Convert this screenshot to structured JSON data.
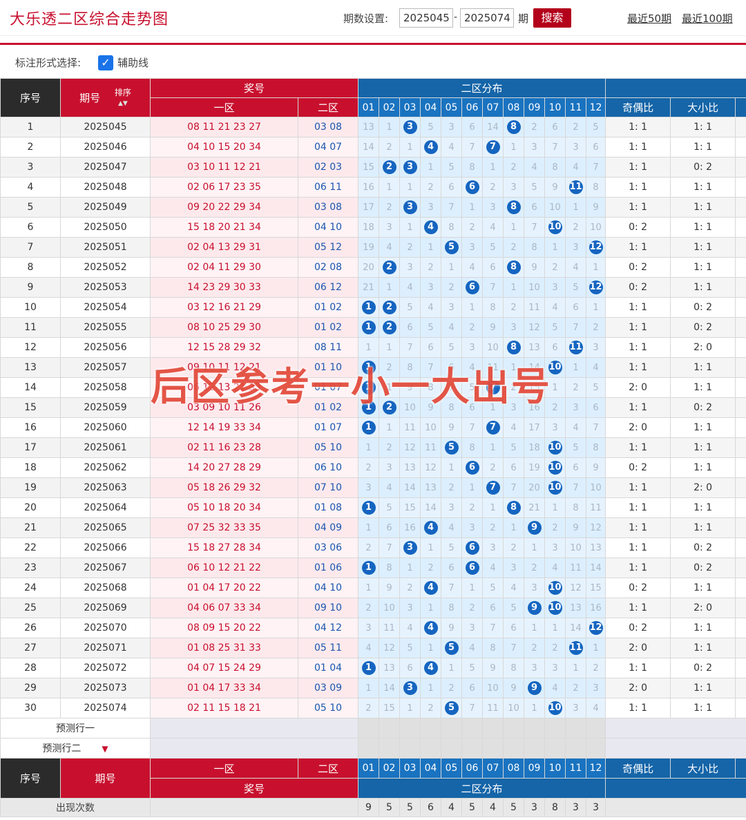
{
  "header": {
    "title": "大乐透二区综合走势图",
    "period_label": "期数设置:",
    "period_start": "2025045",
    "period_sep": "-",
    "period_end": "2025074",
    "period_unit": "期",
    "search_label": "搜索",
    "recent_50": "最近50期",
    "recent_100": "最近100期"
  },
  "options": {
    "label": "标注形式选择:",
    "aux_line_label": "辅助线",
    "aux_line_checked": true
  },
  "table_head": {
    "seq": "序号",
    "issue": "期号",
    "sort": "排序",
    "prize": "奖号",
    "zone1": "一区",
    "zone2": "二区",
    "dist": "二区分布",
    "odd_even": "奇偶比",
    "big_small": "大小比",
    "numbers": [
      "01",
      "02",
      "03",
      "04",
      "05",
      "06",
      "07",
      "08",
      "09",
      "10",
      "11",
      "12"
    ]
  },
  "rows": [
    {
      "seq": "1",
      "issue": "2025045",
      "front": "08 11 21 23 27",
      "back": "03 08",
      "cells": [
        "13",
        "1",
        "3",
        "5",
        "3",
        "6",
        "14",
        "8",
        "2",
        "6",
        "2",
        "5"
      ],
      "odd_even": "1: 1",
      "big_small": "1: 1"
    },
    {
      "seq": "2",
      "issue": "2025046",
      "front": "04 10 15 20 34",
      "back": "04 07",
      "cells": [
        "14",
        "2",
        "1",
        "4",
        "4",
        "7",
        "7",
        "1",
        "3",
        "7",
        "3",
        "6"
      ],
      "odd_even": "1: 1",
      "big_small": "1: 1"
    },
    {
      "seq": "3",
      "issue": "2025047",
      "front": "03 10 11 12 21",
      "back": "02 03",
      "cells": [
        "15",
        "2",
        "3",
        "1",
        "5",
        "8",
        "1",
        "2",
        "4",
        "8",
        "4",
        "7"
      ],
      "odd_even": "1: 1",
      "big_small": "0: 2"
    },
    {
      "seq": "4",
      "issue": "2025048",
      "front": "02 06 17 23 35",
      "back": "06 11",
      "cells": [
        "16",
        "1",
        "1",
        "2",
        "6",
        "6",
        "2",
        "3",
        "5",
        "9",
        "11",
        "8"
      ],
      "odd_even": "1: 1",
      "big_small": "1: 1"
    },
    {
      "seq": "5",
      "issue": "2025049",
      "front": "09 20 22 29 34",
      "back": "03 08",
      "cells": [
        "17",
        "2",
        "3",
        "3",
        "7",
        "1",
        "3",
        "8",
        "6",
        "10",
        "1",
        "9"
      ],
      "odd_even": "1: 1",
      "big_small": "1: 1"
    },
    {
      "seq": "6",
      "issue": "2025050",
      "front": "15 18 20 21 34",
      "back": "04 10",
      "cells": [
        "18",
        "3",
        "1",
        "4",
        "8",
        "2",
        "4",
        "1",
        "7",
        "10",
        "2",
        "10"
      ],
      "odd_even": "0: 2",
      "big_small": "1: 1"
    },
    {
      "seq": "7",
      "issue": "2025051",
      "front": "02 04 13 29 31",
      "back": "05 12",
      "cells": [
        "19",
        "4",
        "2",
        "1",
        "5",
        "3",
        "5",
        "2",
        "8",
        "1",
        "3",
        "12"
      ],
      "odd_even": "1: 1",
      "big_small": "1: 1"
    },
    {
      "seq": "8",
      "issue": "2025052",
      "front": "02 04 11 29 30",
      "back": "02 08",
      "cells": [
        "20",
        "2",
        "3",
        "2",
        "1",
        "4",
        "6",
        "8",
        "9",
        "2",
        "4",
        "1"
      ],
      "odd_even": "0: 2",
      "big_small": "1: 1"
    },
    {
      "seq": "9",
      "issue": "2025053",
      "front": "14 23 29 30 33",
      "back": "06 12",
      "cells": [
        "21",
        "1",
        "4",
        "3",
        "2",
        "6",
        "7",
        "1",
        "10",
        "3",
        "5",
        "12"
      ],
      "odd_even": "0: 2",
      "big_small": "1: 1"
    },
    {
      "seq": "10",
      "issue": "2025054",
      "front": "03 12 16 21 29",
      "back": "01 02",
      "cells": [
        "1",
        "2",
        "5",
        "4",
        "3",
        "1",
        "8",
        "2",
        "11",
        "4",
        "6",
        "1"
      ],
      "odd_even": "1: 1",
      "big_small": "0: 2"
    },
    {
      "seq": "11",
      "issue": "2025055",
      "front": "08 10 25 29 30",
      "back": "01 02",
      "cells": [
        "1",
        "2",
        "6",
        "5",
        "4",
        "2",
        "9",
        "3",
        "12",
        "5",
        "7",
        "2"
      ],
      "odd_even": "1: 1",
      "big_small": "0: 2"
    },
    {
      "seq": "12",
      "issue": "2025056",
      "front": "12 15 28 29 32",
      "back": "08 11",
      "cells": [
        "1",
        "1",
        "7",
        "6",
        "5",
        "3",
        "10",
        "8",
        "13",
        "6",
        "11",
        "3"
      ],
      "odd_even": "1: 1",
      "big_small": "2: 0"
    },
    {
      "seq": "13",
      "issue": "2025057",
      "front": "09 10 11 12 21",
      "back": "01 10",
      "cells": [
        "1",
        "2",
        "8",
        "7",
        "6",
        "4",
        "11",
        "1",
        "14",
        "10",
        "1",
        "4"
      ],
      "odd_even": "1: 1",
      "big_small": "1: 1"
    },
    {
      "seq": "14",
      "issue": "2025058",
      "front": "06 12 13 21 33",
      "back": "01 07",
      "cells": [
        "1",
        "1",
        "9",
        "8",
        "7",
        "5",
        "7",
        "2",
        "15",
        "1",
        "2",
        "5"
      ],
      "odd_even": "2: 0",
      "big_small": "1: 1"
    },
    {
      "seq": "15",
      "issue": "2025059",
      "front": "03 09 10 11 26",
      "back": "01 02",
      "cells": [
        "1",
        "2",
        "10",
        "9",
        "8",
        "6",
        "1",
        "3",
        "16",
        "2",
        "3",
        "6"
      ],
      "odd_even": "1: 1",
      "big_small": "0: 2"
    },
    {
      "seq": "16",
      "issue": "2025060",
      "front": "12 14 19 33 34",
      "back": "01 07",
      "cells": [
        "1",
        "1",
        "11",
        "10",
        "9",
        "7",
        "7",
        "4",
        "17",
        "3",
        "4",
        "7"
      ],
      "odd_even": "2: 0",
      "big_small": "1: 1"
    },
    {
      "seq": "17",
      "issue": "2025061",
      "front": "02 11 16 23 28",
      "back": "05 10",
      "cells": [
        "1",
        "2",
        "12",
        "11",
        "5",
        "8",
        "1",
        "5",
        "18",
        "10",
        "5",
        "8"
      ],
      "odd_even": "1: 1",
      "big_small": "1: 1"
    },
    {
      "seq": "18",
      "issue": "2025062",
      "front": "14 20 27 28 29",
      "back": "06 10",
      "cells": [
        "2",
        "3",
        "13",
        "12",
        "1",
        "6",
        "2",
        "6",
        "19",
        "10",
        "6",
        "9"
      ],
      "odd_even": "0: 2",
      "big_small": "1: 1"
    },
    {
      "seq": "19",
      "issue": "2025063",
      "front": "05 18 26 29 32",
      "back": "07 10",
      "cells": [
        "3",
        "4",
        "14",
        "13",
        "2",
        "1",
        "7",
        "7",
        "20",
        "10",
        "7",
        "10"
      ],
      "odd_even": "1: 1",
      "big_small": "2: 0"
    },
    {
      "seq": "20",
      "issue": "2025064",
      "front": "05 10 18 20 34",
      "back": "01 08",
      "cells": [
        "1",
        "5",
        "15",
        "14",
        "3",
        "2",
        "1",
        "8",
        "21",
        "1",
        "8",
        "11"
      ],
      "odd_even": "1: 1",
      "big_small": "1: 1"
    },
    {
      "seq": "21",
      "issue": "2025065",
      "front": "07 25 32 33 35",
      "back": "04 09",
      "cells": [
        "1",
        "6",
        "16",
        "4",
        "4",
        "3",
        "2",
        "1",
        "9",
        "2",
        "9",
        "12"
      ],
      "odd_even": "1: 1",
      "big_small": "1: 1"
    },
    {
      "seq": "22",
      "issue": "2025066",
      "front": "15 18 27 28 34",
      "back": "03 06",
      "cells": [
        "2",
        "7",
        "3",
        "1",
        "5",
        "6",
        "3",
        "2",
        "1",
        "3",
        "10",
        "13"
      ],
      "odd_even": "1: 1",
      "big_small": "0: 2"
    },
    {
      "seq": "23",
      "issue": "2025067",
      "front": "06 10 12 21 22",
      "back": "01 06",
      "cells": [
        "1",
        "8",
        "1",
        "2",
        "6",
        "6",
        "4",
        "3",
        "2",
        "4",
        "11",
        "14"
      ],
      "odd_even": "1: 1",
      "big_small": "0: 2"
    },
    {
      "seq": "24",
      "issue": "2025068",
      "front": "01 04 17 20 22",
      "back": "04 10",
      "cells": [
        "1",
        "9",
        "2",
        "4",
        "7",
        "1",
        "5",
        "4",
        "3",
        "10",
        "12",
        "15"
      ],
      "odd_even": "0: 2",
      "big_small": "1: 1"
    },
    {
      "seq": "25",
      "issue": "2025069",
      "front": "04 06 07 33 34",
      "back": "09 10",
      "cells": [
        "2",
        "10",
        "3",
        "1",
        "8",
        "2",
        "6",
        "5",
        "9",
        "10",
        "13",
        "16"
      ],
      "odd_even": "1: 1",
      "big_small": "2: 0"
    },
    {
      "seq": "26",
      "issue": "2025070",
      "front": "08 09 15 20 22",
      "back": "04 12",
      "cells": [
        "3",
        "11",
        "4",
        "4",
        "9",
        "3",
        "7",
        "6",
        "1",
        "1",
        "14",
        "12"
      ],
      "odd_even": "0: 2",
      "big_small": "1: 1"
    },
    {
      "seq": "27",
      "issue": "2025071",
      "front": "01 08 25 31 33",
      "back": "05 11",
      "cells": [
        "4",
        "12",
        "5",
        "1",
        "5",
        "4",
        "8",
        "7",
        "2",
        "2",
        "11",
        "1"
      ],
      "odd_even": "2: 0",
      "big_small": "1: 1"
    },
    {
      "seq": "28",
      "issue": "2025072",
      "front": "04 07 15 24 29",
      "back": "01 04",
      "cells": [
        "1",
        "13",
        "6",
        "4",
        "1",
        "5",
        "9",
        "8",
        "3",
        "3",
        "1",
        "2"
      ],
      "odd_even": "1: 1",
      "big_small": "0: 2"
    },
    {
      "seq": "29",
      "issue": "2025073",
      "front": "01 04 17 33 34",
      "back": "03 09",
      "cells": [
        "1",
        "14",
        "3",
        "1",
        "2",
        "6",
        "10",
        "9",
        "9",
        "4",
        "2",
        "3"
      ],
      "odd_even": "2: 0",
      "big_small": "1: 1"
    },
    {
      "seq": "30",
      "issue": "2025074",
      "front": "02 11 15 18 21",
      "back": "05 10",
      "cells": [
        "2",
        "15",
        "1",
        "2",
        "5",
        "7",
        "11",
        "10",
        "1",
        "10",
        "3",
        "4"
      ],
      "odd_even": "1: 1",
      "big_small": "1: 1"
    }
  ],
  "prediction": {
    "row1": "预测行一",
    "row2": "预测行二"
  },
  "footer": {
    "seq": "序号",
    "issue": "期号",
    "zone1": "一区",
    "zone2": "二区",
    "prize": "奖号",
    "dist": "二区分布",
    "odd_even": "奇偶比",
    "big_small": "大小比",
    "count_label": "出现次数",
    "counts": [
      "9",
      "5",
      "5",
      "6",
      "4",
      "5",
      "4",
      "5",
      "3",
      "8",
      "3",
      "3"
    ]
  },
  "overlay_caption": "后区参考一小一大出号",
  "colors": {
    "brand_red": "#c8102e",
    "ball_blue": "#1565c0",
    "zone_bg": "#dcefff",
    "header_blue": "#1565a8"
  }
}
